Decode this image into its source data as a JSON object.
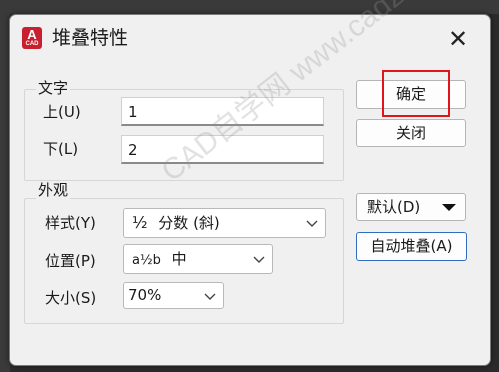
{
  "window": {
    "title": "堆叠特性",
    "app_icon_letter": "A",
    "app_icon_sub": "CAD",
    "close_glyph": "✕"
  },
  "text_group": {
    "label": "文字",
    "upper_label": "上(U)",
    "upper_value": "1",
    "lower_label": "下(L)",
    "lower_value": "2"
  },
  "appearance_group": {
    "label": "外观",
    "style_label": "样式(Y)",
    "style_icon": "½",
    "style_value": "分数 (斜)",
    "position_label": "位置(P)",
    "position_icon": "a½b",
    "position_value": "中",
    "size_label": "大小(S)",
    "size_value": "70%"
  },
  "buttons": {
    "ok": "确定",
    "close": "关闭",
    "default": "默认(D)",
    "auto_stack": "自动堆叠(A)"
  },
  "watermark": "CAD自学网 www.cadzxw.com",
  "colors": {
    "dialog_bg": "#f0f0f0",
    "highlight": "#e0141a",
    "app_icon": "#c8202f",
    "primary_border": "#2f6dbf"
  }
}
